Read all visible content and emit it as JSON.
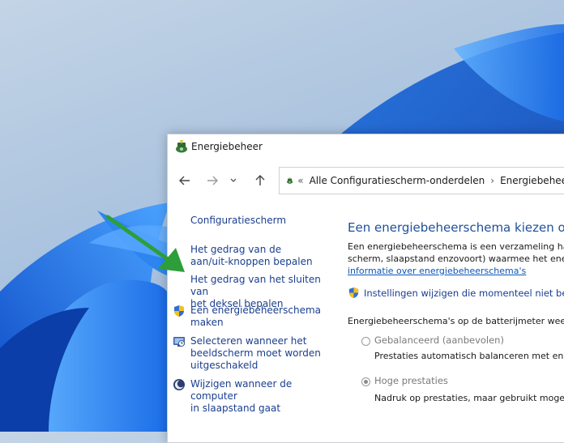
{
  "window": {
    "title": "Energiebeheer"
  },
  "navigation": {
    "back_icon": "arrow-left-icon",
    "forward_icon": "arrow-right-icon",
    "recent_icon": "chevron-down-icon",
    "up_icon": "arrow-up-icon",
    "breadcrumb_prefix": "«",
    "breadcrumb": [
      "Alle Configuratiescherm-onderdelen",
      "Energiebeheer"
    ],
    "separator": "›"
  },
  "sidebar": {
    "home": "Configuratiescherm",
    "items": [
      {
        "line1": "Het gedrag van de",
        "line2": "aan/uit-knoppen bepalen"
      },
      {
        "line1": "Het gedrag van het sluiten van",
        "line2": "het deksel bepalen"
      },
      {
        "line1": "Een energiebeheerschema",
        "line2": "maken",
        "icon": "shield-icon"
      },
      {
        "line1": "Selecteren wanneer het",
        "line2": "beeldscherm moet worden",
        "line3": "uitgeschakeld",
        "icon": "monitor-clock-icon"
      },
      {
        "line1": "Wijzigen wanneer de computer",
        "line2": "in slaapstand gaat",
        "icon": "moon-icon"
      }
    ]
  },
  "main": {
    "title": "Een energiebeheerschema kiezen of aa",
    "para_line1": "Een energiebeheerschema is een verzameling hardv",
    "para_line2": "scherm, slaapstand enzovoort) waarmee het energi",
    "info_link": "informatie over energiebeheerschema's",
    "change_settings": "Instellingen wijzigen die momenteel niet besch",
    "plans_label": "Energiebeheerschema's op de batterijmeter weerge",
    "plans": [
      {
        "name": "Gebalanceerd (aanbevolen)",
        "description": "Prestaties automatisch balanceren met energ",
        "selected": false
      },
      {
        "name": "Hoge prestaties",
        "description": "Nadruk op prestaties, maar gebruikt mogelijl",
        "selected": true
      }
    ]
  },
  "annotation": {
    "arrow_color": "#2e9e3a"
  }
}
